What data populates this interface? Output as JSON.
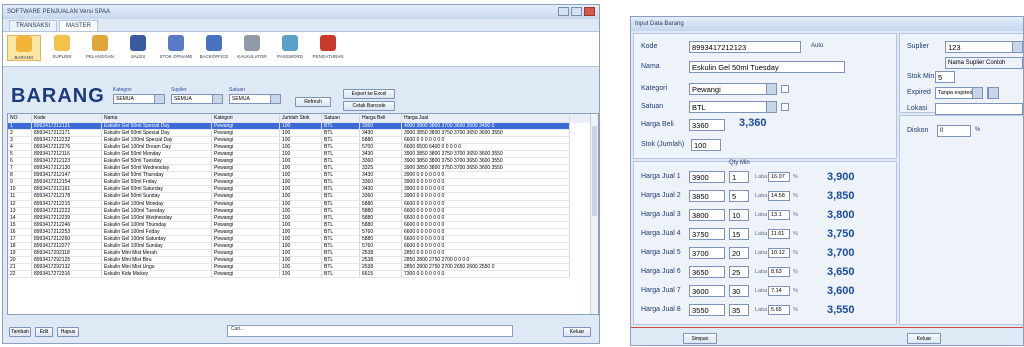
{
  "w1": {
    "title": "SOFTWARE PENJUALAN Versi SPAA",
    "tabs": [
      "TRANSAKSI",
      "MASTER"
    ],
    "ribbon": [
      {
        "label": "BARANG",
        "icon": "box-icon",
        "color": "#f2b53a"
      },
      {
        "label": "SUPLIER",
        "icon": "supplier-icon",
        "color": "#f2c24a"
      },
      {
        "label": "PELANGGAN",
        "icon": "customer-icon",
        "color": "#e0a63a"
      },
      {
        "label": "SALES",
        "icon": "sales-icon",
        "color": "#3a5aa0"
      },
      {
        "label": "STOK OPNAME",
        "icon": "stock-icon",
        "color": "#5a7ac8"
      },
      {
        "label": "BACKOFFICE",
        "icon": "backoffice-icon",
        "color": "#4a70c0"
      },
      {
        "label": "KALKULATOR",
        "icon": "calculator-icon",
        "color": "#909aa8"
      },
      {
        "label": "PASSWORD",
        "icon": "key-icon",
        "color": "#5aa0c8"
      },
      {
        "label": "PENGATURAN",
        "icon": "settings-icon",
        "color": "#c83a2a"
      }
    ],
    "heading": "BARANG",
    "filters": [
      {
        "label": "Kategori",
        "value": "SEMUA"
      },
      {
        "label": "Suplier",
        "value": "SEMUA"
      },
      {
        "label": "Satuan",
        "value": "SEMUA"
      }
    ],
    "refresh": "Refresh",
    "export": "Export ke Excel",
    "print": "Cetak Barcode",
    "columns": [
      "NO",
      "Kode",
      "Nama",
      "Kategori",
      "Jumlah Stok",
      "Satuan",
      "Harga Beli",
      "Harga Jual"
    ],
    "rows": [
      [
        "1",
        "8993417212121",
        "Eskulin Gel 50ml Special Day",
        "Pewangi",
        "100",
        "BTL",
        "3360",
        "4000  3900  3800  3700  3600  3500  3400  0"
      ],
      [
        "2",
        "8993417212171",
        "Eskulin Gel 50ml Special Day",
        "Pewangi",
        "100",
        "BTL",
        "3430",
        "3900  3850  3800  3750  3700  3650  3600  3550"
      ],
      [
        "3",
        "8993417212232",
        "Eskulin Gel 100ml Special Day",
        "Pewangi",
        "100",
        "BTL",
        "5880",
        "6600  0  0  0  0  0  0  0"
      ],
      [
        "4",
        "8993417212276",
        "Eskulin Gel 100ml Dream Day",
        "Pewangi",
        "100",
        "BTL",
        "5700",
        "6600  6500  6400  0  0  0  0  0"
      ],
      [
        "5",
        "8993417212116",
        "Eskulin Gel 50ml Monday",
        "Pewangi",
        "100",
        "BTL",
        "3430",
        "3900  3850  3800  3750  3700  3650  3600  3550"
      ],
      [
        "6",
        "8993417212123",
        "Eskulin Gel 50ml Tuesday",
        "Pewangi",
        "100",
        "BTL",
        "3360",
        "3900  3850  3800  3750  3700  3650  3600  3550"
      ],
      [
        "7",
        "8993417212130",
        "Eskulin Gel 50ml Wednesday",
        "Pewangi",
        "100",
        "BTL",
        "3325",
        "3900  3850  3800  3750  3700  3650  3600  3550"
      ],
      [
        "8",
        "8993417212147",
        "Eskulin Gel 50ml Thursday",
        "Pewangi",
        "100",
        "BTL",
        "3430",
        "3900  0  0  0  0  0  0  0"
      ],
      [
        "9",
        "8993417212154",
        "Eskulin Gel 50ml Friday",
        "Pewangi",
        "100",
        "BTL",
        "3360",
        "3900  0  0  0  0  0  0  0"
      ],
      [
        "10",
        "8993417212161",
        "Eskulin Gel 50ml Saturday",
        "Pewangi",
        "100",
        "BTL",
        "3430",
        "3900  0  0  0  0  0  0  0"
      ],
      [
        "11",
        "8993417212178",
        "Eskulin Gel 50ml Sunday",
        "Pewangi",
        "100",
        "BTL",
        "3360",
        "3900  0  0  0  0  0  0  0"
      ],
      [
        "12",
        "8993417212215",
        "Eskulin Gel 100ml Monday",
        "Pewangi",
        "100",
        "BTL",
        "5880",
        "6600  0  0  0  0  0  0  0"
      ],
      [
        "13",
        "8993417212222",
        "Eskulin Gel 100ml Tuesday",
        "Pewangi",
        "100",
        "BTL",
        "5880",
        "6600  0  0  0  0  0  0  0"
      ],
      [
        "14",
        "8993417212239",
        "Eskulin Gel 100ml Wednesday",
        "Pewangi",
        "100",
        "BTL",
        "5880",
        "6600  0  0  0  0  0  0  0"
      ],
      [
        "15",
        "8993417212246",
        "Eskulin Gel 100ml Thursday",
        "Pewangi",
        "100",
        "BTL",
        "5880",
        "6600  0  0  0  0  0  0  0"
      ],
      [
        "16",
        "8993417212253",
        "Eskulin Gel 100ml Friday",
        "Pewangi",
        "100",
        "BTL",
        "5760",
        "6600  0  0  0  0  0  0  0"
      ],
      [
        "17",
        "8993417212260",
        "Eskulin Gel 100ml Saturday",
        "Pewangi",
        "100",
        "BTL",
        "5880",
        "6600  0  0  0  0  0  0  0"
      ],
      [
        "18",
        "8993417212277",
        "Eskulin Gel 100ml Sunday",
        "Pewangi",
        "100",
        "BTL",
        "5760",
        "6600  0  0  0  0  0  0  0"
      ],
      [
        "19",
        "8993417292118",
        "Eskulin Mini Mist Merah",
        "Pewangi",
        "100",
        "BTL",
        "2538",
        "2850  0  0  0  0  0  0  0"
      ],
      [
        "20",
        "8993417292125",
        "Eskulin Mini Mist Biru",
        "Pewangi",
        "100",
        "BTL",
        "2538",
        "2850  2800  2750  2700  0  0  0  0"
      ],
      [
        "21",
        "8993417292132",
        "Eskulin Mini Mist Ungu",
        "Pewangi",
        "100",
        "BTL",
        "2538",
        "2850  2800  2750  2700  2650  2600  2550  0"
      ],
      [
        "22",
        "8993417272316",
        "Eskulin Kids Mickey",
        "Pewangi",
        "100",
        "BTL",
        "6615",
        "7300  0  0  0  0  0  0  0"
      ]
    ],
    "btn_add": "Tambah",
    "btn_edit": "Edit",
    "btn_delete": "Hapus",
    "search_placeholder": "Cari...",
    "btn_exit": "Keluar"
  },
  "w2": {
    "title": "Input Data Barang",
    "kode_label": "Kode",
    "kode": "8993417212123",
    "auto": "Auto",
    "nama_label": "Nama",
    "nama": "Eskulin Gel 50ml Tuesday",
    "kategori_label": "Kategori",
    "kategori": "Pewangi",
    "satuan_label": "Satuan",
    "satuan": "BTL",
    "hbeli_label": "Harga Beli",
    "hbeli": "3360",
    "hbeli_fmt": "3,360",
    "stok_label": "Stok (Jumlah)",
    "stok": "100",
    "qty_min_label": "Qty Min",
    "laba_label": "Laba",
    "pct": "%",
    "hj": [
      {
        "label": "Harga Jual 1",
        "harga": "3900",
        "qty": "1",
        "laba": "16.07",
        "fmt": "3,900"
      },
      {
        "label": "Harga Jual 2",
        "harga": "3850",
        "qty": "5",
        "laba": "14.58",
        "fmt": "3,850"
      },
      {
        "label": "Harga Jual 3",
        "harga": "3800",
        "qty": "10",
        "laba": "13.1",
        "fmt": "3,800"
      },
      {
        "label": "Harga Jual 4",
        "harga": "3750",
        "qty": "15",
        "laba": "11.61",
        "fmt": "3,750"
      },
      {
        "label": "Harga Jual 5",
        "harga": "3700",
        "qty": "20",
        "laba": "10.12",
        "fmt": "3,700"
      },
      {
        "label": "Harga Jual 6",
        "harga": "3650",
        "qty": "25",
        "laba": "8.63",
        "fmt": "3,650"
      },
      {
        "label": "Harga Jual 7",
        "harga": "3600",
        "qty": "30",
        "laba": "7.14",
        "fmt": "3,600"
      },
      {
        "label": "Harga Jual 8",
        "harga": "3550",
        "qty": "35",
        "laba": "5.65",
        "fmt": "3,550"
      }
    ],
    "suplier_label": "Suplier",
    "suplier": "123",
    "suplier_name": "Nama Suplier Contoh",
    "stokmin_label": "Stok Min",
    "stokmin": "5",
    "expired_label": "Expired",
    "expired": "Tanpa expired",
    "lokasi_label": "Lokasi",
    "diskon_label": "Diskon",
    "diskon": "0",
    "btn_save": "Simpan",
    "btn_exit": "Keluar"
  }
}
